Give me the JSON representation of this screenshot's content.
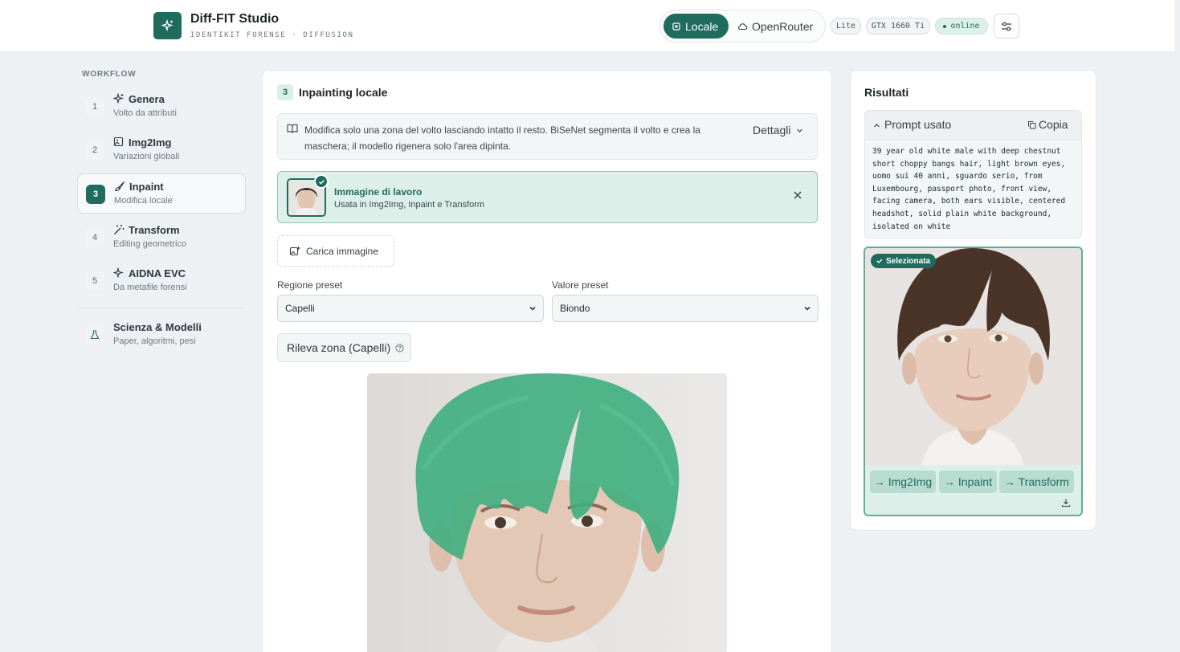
{
  "header": {
    "title": "Diff-FIT Studio",
    "subtitle": "IDENTIKIT FORENSE · DIFFUSION",
    "modes": [
      {
        "label": "Locale",
        "active": true
      },
      {
        "label": "OpenRouter",
        "active": false
      }
    ],
    "badges": [
      "Lite",
      "GTX 1660 Ti",
      "online"
    ]
  },
  "sidebar": {
    "section_label": "WORKFLOW",
    "items": [
      {
        "num": "1",
        "title": "Genera",
        "sub": "Volto da attributi",
        "icon": "sparkle-icon"
      },
      {
        "num": "2",
        "title": "Img2Img",
        "sub": "Variazioni globali",
        "icon": "image-edit-icon"
      },
      {
        "num": "3",
        "title": "Inpaint",
        "sub": "Modifica locale",
        "icon": "brush-icon",
        "active": true
      },
      {
        "num": "4",
        "title": "Transform",
        "sub": "Editing geometrico",
        "icon": "wand-icon"
      },
      {
        "num": "5",
        "title": "AIDNA EVC",
        "sub": "Da metafile forensi",
        "icon": "sparkle-icon"
      }
    ],
    "extra": {
      "title": "Scienza & Modelli",
      "sub": "Paper, algoritmi, pesi",
      "icon": "flask-icon"
    }
  },
  "main": {
    "step": "3",
    "title": "Inpainting locale",
    "info_text": "Modifica solo una zona del volto lasciando intatto il resto. BiSeNet segmenta il volto e crea la maschera; il modello rigenera solo l'area dipinta.",
    "info_more": "Dettagli",
    "work_image": {
      "title": "Immagine di lavoro",
      "sub": "Usata in Img2Img, Inpaint e Transform"
    },
    "upload_label": "Carica immagine",
    "region_label": "Regione preset",
    "region_value": "Capelli",
    "value_label": "Valore preset",
    "value_value": "Biondo",
    "detect_label": "Rileva zona (Capelli)"
  },
  "results": {
    "title": "Risultati",
    "prompt_label": "Prompt usato",
    "copy_label": "Copia",
    "prompt_text": "39 year old white male with deep chestnut\nshort choppy bangs hair, light brown eyes,\nuomo sui 40 anni, sguardo serio, from\nLuxembourg, passport photo, front view,\nfacing camera, both ears visible, centered\nheadshot, solid plain white background,\nisolated on white",
    "selected_label": "Selezionata",
    "actions": [
      "→ Img2Img",
      "→ Inpaint",
      "→ Transform"
    ]
  },
  "colors": {
    "accent": "#1f6b5d",
    "accent_light": "#dcefe9",
    "mask": "#3fae80"
  }
}
